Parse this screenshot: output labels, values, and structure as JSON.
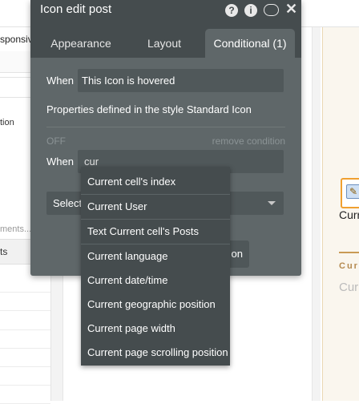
{
  "background": {
    "left_panel": {
      "responsive_label": "sponsive",
      "truncated_label": "tion",
      "search_placeholder": "ments...",
      "tab_label": "ts"
    },
    "canvas_right": {
      "element_label": "Curr",
      "text_a": "Cur",
      "text_b": "Cur"
    }
  },
  "panel": {
    "title": "Icon edit post",
    "header_icons": [
      "help-icon",
      "info-icon",
      "comment-icon",
      "close-icon"
    ],
    "help_glyph": "?",
    "info_glyph": "i",
    "close_glyph": "✕",
    "tabs": [
      {
        "label": "Appearance",
        "active": false
      },
      {
        "label": "Layout",
        "active": false
      },
      {
        "label": "Conditional (1)",
        "active": true
      }
    ],
    "condition_1": {
      "when_label": "When",
      "when_value": "This Icon is hovered",
      "properties_text": "Properties defined in the style Standard Icon"
    },
    "condition_2": {
      "status": "OFF",
      "remove_label": "remove condition",
      "when_label": "When",
      "when_value": "cur",
      "select_placeholder": "Select",
      "button_partial_label": "on"
    }
  },
  "dropdown": {
    "items": [
      "Current cell's index",
      "Current User",
      "Text Current cell's Posts",
      "Current language",
      "Current date/time",
      "Current geographic position",
      "Current page width",
      "Current page scrolling position"
    ]
  },
  "colors": {
    "panel_bg": "#5f6769",
    "panel_header": "#454c4e",
    "accent_orange": "#f0a030"
  }
}
